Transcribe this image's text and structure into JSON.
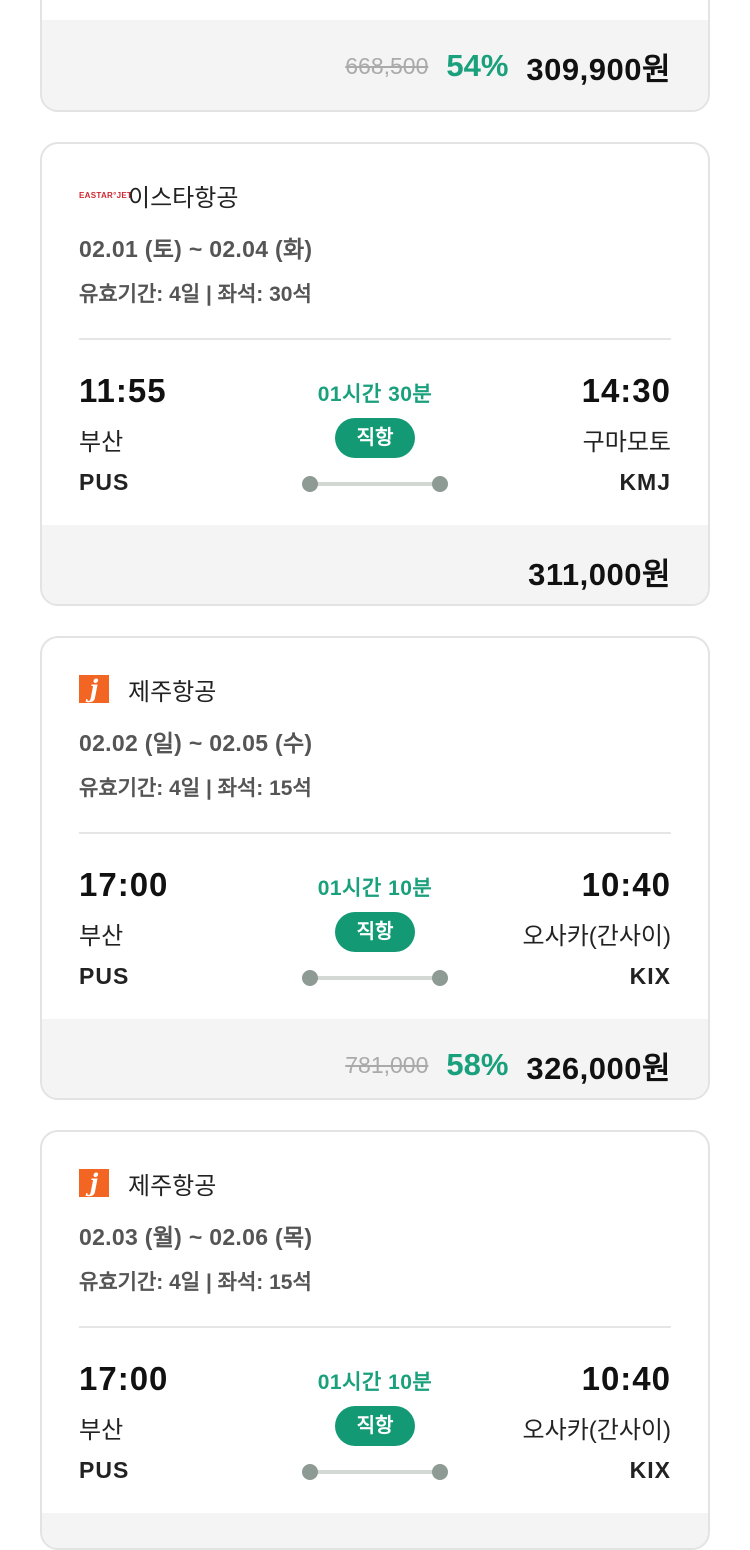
{
  "cards": [
    {
      "price": {
        "original": "668,500",
        "discount": "54%",
        "final": "309,900원"
      }
    },
    {
      "airline": {
        "name": "이스타항공",
        "logo_text": "EASTAR°JET"
      },
      "dates": "02.01 (토) ~ 02.04 (화)",
      "meta": "유효기간: 4일 | 좌석: 30석",
      "departure": {
        "time": "11:55",
        "city": "부산",
        "code": "PUS"
      },
      "arrival": {
        "time": "14:30",
        "city": "구마모토",
        "code": "KMJ"
      },
      "duration": "01시간 30분",
      "badge": "직항",
      "price": {
        "final": "311,000원"
      }
    },
    {
      "airline": {
        "name": "제주항공",
        "logo_text": "j"
      },
      "dates": "02.02 (일) ~ 02.05 (수)",
      "meta": "유효기간: 4일 | 좌석: 15석",
      "departure": {
        "time": "17:00",
        "city": "부산",
        "code": "PUS"
      },
      "arrival": {
        "time": "10:40",
        "city": "오사카(간사이)",
        "code": "KIX"
      },
      "duration": "01시간 10분",
      "badge": "직항",
      "price": {
        "original": "781,000",
        "discount": "58%",
        "final": "326,000원"
      }
    },
    {
      "airline": {
        "name": "제주항공",
        "logo_text": "j"
      },
      "dates": "02.03 (월) ~ 02.06 (목)",
      "meta": "유효기간: 4일 | 좌석: 15석",
      "departure": {
        "time": "17:00",
        "city": "부산",
        "code": "PUS"
      },
      "arrival": {
        "time": "10:40",
        "city": "오사카(간사이)",
        "code": "KIX"
      },
      "duration": "01시간 10분",
      "badge": "직항"
    }
  ],
  "colors": {
    "accent": "#1aa07c",
    "badge": "#139a75",
    "jeju": "#f26522",
    "eastar": "#d0262f"
  }
}
